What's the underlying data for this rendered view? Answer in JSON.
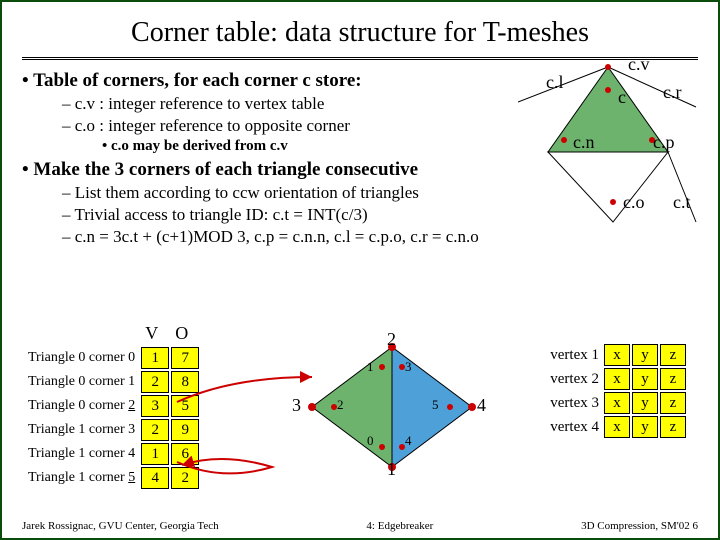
{
  "title": "Corner table: data structure for T-meshes",
  "bullets": {
    "b1a": "Table of corners, for each corner c store:",
    "b2a": "c.v : integer reference to vertex table",
    "b2b": "c.o : integer reference to opposite corner",
    "b3a": "c.o may be derived from c.v",
    "b1b": "Make the 3 corners of each triangle consecutive",
    "b2c": "List them according to ccw orientation of triangles",
    "b2d": "Trivial access to triangle ID: c.t = INT(c/3)",
    "b2e": "c.n = 3c.t + (c+1)MOD 3, c.p =  c.n.n, c.l = c.p.o, c.r =  c.n.o"
  },
  "labels": {
    "cv": "c.v",
    "cl": "c.l",
    "cr": "c.r",
    "c": "c",
    "cn": "c.n",
    "cp": "c.p",
    "co": "c.o",
    "ct": "c.t"
  },
  "vo_header": {
    "v": "V",
    "o": "O"
  },
  "corner_rows": [
    {
      "label": "Triangle 0 corner 0",
      "v": "1",
      "o": "7"
    },
    {
      "label": "Triangle 0 corner 1",
      "v": "2",
      "o": "8"
    },
    {
      "label": "Triangle 0 corner 2",
      "v": "3",
      "o": "5",
      "hl": true
    },
    {
      "label": "Triangle 1 corner 3",
      "v": "2",
      "o": "9"
    },
    {
      "label": "Triangle 1 corner 4",
      "v": "1",
      "o": "6"
    },
    {
      "label": "Triangle 1 corner 5",
      "v": "4",
      "o": "2",
      "hl": true
    }
  ],
  "vertex_rows": [
    {
      "label": "vertex 1",
      "x": "x",
      "y": "y",
      "z": "z"
    },
    {
      "label": "vertex 2",
      "x": "x",
      "y": "y",
      "z": "z"
    },
    {
      "label": "vertex 3",
      "x": "x",
      "y": "y",
      "z": "z"
    },
    {
      "label": "vertex 4",
      "x": "x",
      "y": "y",
      "z": "z"
    }
  ],
  "tri_verts": {
    "t1": "1",
    "t2": "2",
    "t3": "3",
    "t4": "4"
  },
  "tri_corners": {
    "c0": "0",
    "c1": "1",
    "c2": "2",
    "c3": "3",
    "c4": "4",
    "c5": "5"
  },
  "footer": {
    "left": "Jarek Rossignac, GVU Center, Georgia Tech",
    "mid": "4: Edgebreaker",
    "right": "3D Compression, SM'02  6"
  }
}
